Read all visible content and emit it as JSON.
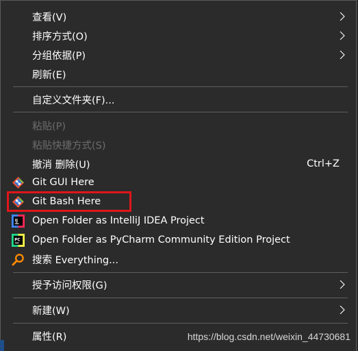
{
  "menu": {
    "view": {
      "label": "查看(V)"
    },
    "sort": {
      "label": "排序方式(O)"
    },
    "group": {
      "label": "分组依据(P)"
    },
    "refresh": {
      "label": "刷新(E)"
    },
    "customize": {
      "label": "自定义文件夹(F)..."
    },
    "paste": {
      "label": "粘贴(P)"
    },
    "paste_shortcut": {
      "label": "粘贴快捷方式(S)"
    },
    "undo_delete": {
      "label": "撤消 删除(U)",
      "shortcut": "Ctrl+Z"
    },
    "git_gui": {
      "label": "Git GUI Here"
    },
    "git_bash": {
      "label": "Git Bash Here"
    },
    "intellij": {
      "label": "Open Folder as IntelliJ IDEA Project"
    },
    "pycharm": {
      "label": "Open Folder as PyCharm Community Edition Project"
    },
    "everything": {
      "label": "搜索 Everything..."
    },
    "grant_access": {
      "label": "授予访问权限(G)"
    },
    "new": {
      "label": "新建(W)"
    },
    "properties": {
      "label": "属性(R)"
    }
  },
  "watermark": "https://blog.csdn.net/weixin_44730681",
  "colors": {
    "menu_background": "#2b2b2b",
    "text": "#ffffff",
    "disabled_text": "#6d6d6d",
    "highlight_border": "#e0161a"
  },
  "icons": {
    "submenu": "chevron-right-icon",
    "git": "git-icon",
    "intellij": "intellij-icon",
    "pycharm": "pycharm-icon",
    "everything": "search-icon"
  }
}
